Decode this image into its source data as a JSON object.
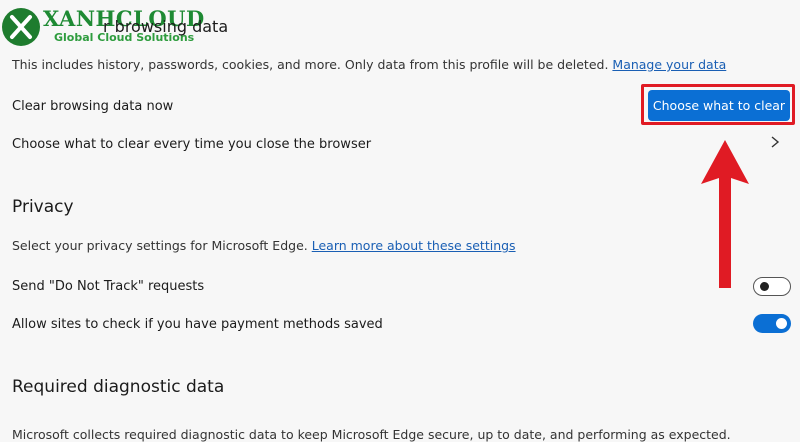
{
  "logo": {
    "name": "XANHCLOUD",
    "tagline": "Global Cloud Solutions"
  },
  "clear_browsing": {
    "title": "Clear browsing data",
    "title_visible": "r browsing data",
    "description": "This includes history, passwords, cookies, and more. Only data from this profile will be deleted.",
    "manage_link": "Manage your data",
    "clear_now_label": "Clear browsing data now",
    "clear_button": "Choose what to clear",
    "on_close_label": "Choose what to clear every time you close the browser"
  },
  "privacy": {
    "title": "Privacy",
    "description": "Select your privacy settings for Microsoft Edge.",
    "learn_link": "Learn more about these settings",
    "dnt_label": "Send \"Do Not Track\" requests",
    "dnt_on": false,
    "payment_label": "Allow sites to check if you have payment methods saved",
    "payment_on": true
  },
  "diagnostic": {
    "title": "Required diagnostic data",
    "description": "Microsoft collects required diagnostic data to keep Microsoft Edge secure, up to date, and performing as expected."
  },
  "colors": {
    "accent": "#0b6fd4",
    "highlight": "#e01b24",
    "logo_green": "#1e8a33"
  },
  "icons": {
    "chevron": "chevron-right-icon",
    "arrow": "red-up-arrow-icon"
  }
}
